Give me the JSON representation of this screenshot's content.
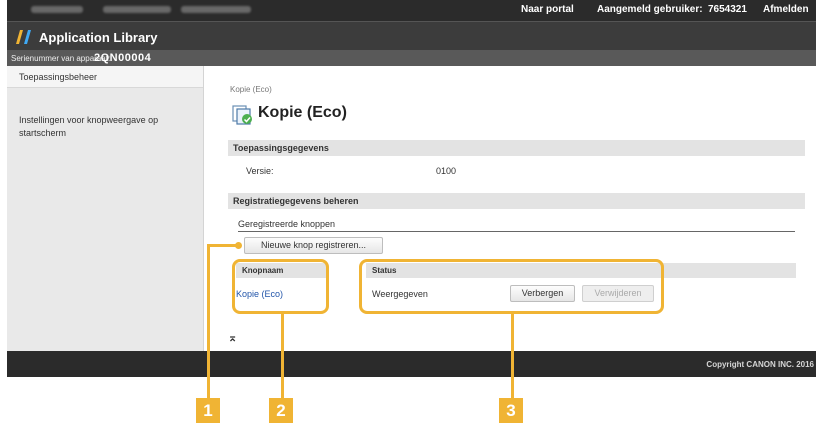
{
  "topbar": {
    "portal_link": "Naar portal",
    "user_label": "Aangemeld gebruiker:",
    "user_id": "7654321",
    "logout_link": "Afmelden"
  },
  "app": {
    "title": "Application Library"
  },
  "serial": {
    "label": "Serienummer van apparaat:",
    "value": "2QN00004"
  },
  "sidebar": {
    "items": [
      {
        "label": "Toepassingsbeheer"
      },
      {
        "label": "Instellingen voor knopweergave op startscherm"
      }
    ]
  },
  "main": {
    "breadcrumb": "Kopie (Eco)",
    "title": "Kopie (Eco)",
    "app_info": {
      "heading": "Toepassingsgegevens",
      "version_label": "Versie:",
      "version_value": "0100"
    },
    "registration": {
      "heading": "Registratiegegevens beheren",
      "registered_buttons": "Geregistreerde knoppen",
      "new_button": "Nieuwe knop registreren...",
      "col_name": "Knopnaam",
      "col_status": "Status",
      "row": {
        "name": "Kopie (Eco)",
        "status": "Weergegeven",
        "hide_button": "Verbergen",
        "delete_button": "Verwijderen"
      }
    },
    "top_icon": "⌅"
  },
  "footer": {
    "copyright": "Copyright CANON INC. 2016"
  },
  "callouts": [
    "1",
    "2",
    "3"
  ],
  "colors": {
    "accent": "#f0b434",
    "topbar": "#2b2b2b",
    "section": "#e3e3e3",
    "link": "#2255aa"
  }
}
